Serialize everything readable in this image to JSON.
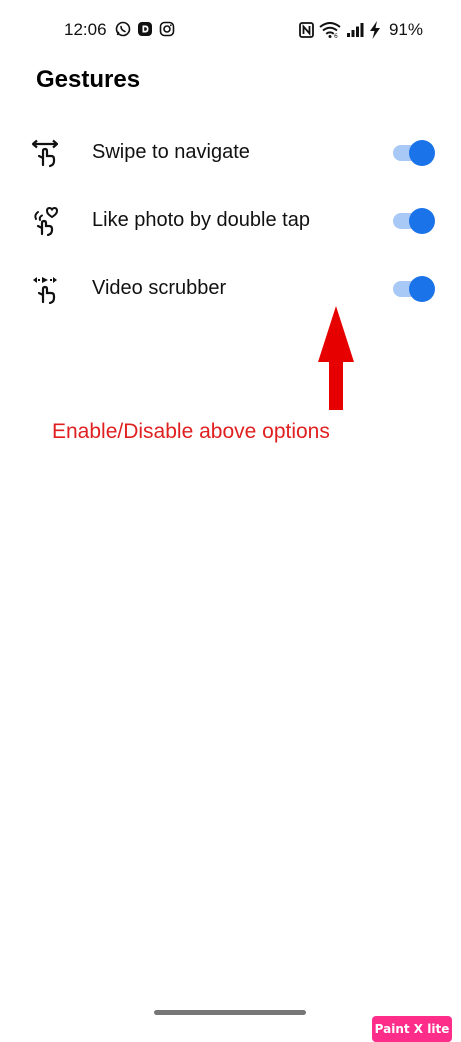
{
  "status_bar": {
    "time": "12:06",
    "battery": "91%",
    "app_icons": [
      "whatsapp-icon",
      "app-d-icon",
      "instagram-icon"
    ],
    "system_icons": [
      "nfc-icon",
      "wifi-icon",
      "signal-icon",
      "charging-icon"
    ]
  },
  "page": {
    "title": "Gestures"
  },
  "settings": [
    {
      "label": "Swipe to navigate",
      "icon": "swipe-gesture-icon",
      "enabled": true
    },
    {
      "label": "Like photo by double tap",
      "icon": "double-tap-heart-icon",
      "enabled": true
    },
    {
      "label": "Video scrubber",
      "icon": "video-scrub-gesture-icon",
      "enabled": true
    }
  ],
  "annotation": {
    "text": "Enable/Disable above options",
    "color": "#e02020"
  },
  "watermark": {
    "text": "Paint X lite",
    "color": "#ff2d8a"
  },
  "colors": {
    "accent": "#1a73e8",
    "track": "#a8c9f5"
  }
}
